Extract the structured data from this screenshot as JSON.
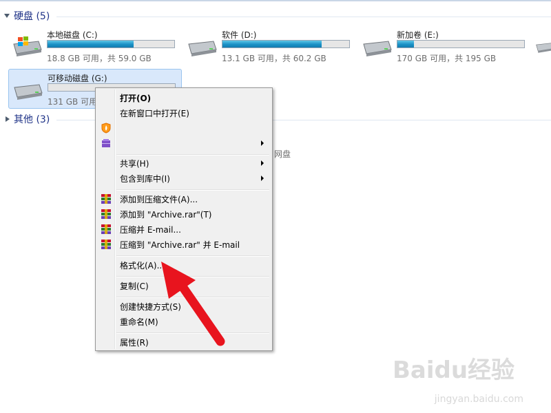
{
  "groups": {
    "disks": {
      "title": "硬盘 (5)"
    },
    "other": {
      "title": "其他 (3)"
    }
  },
  "drives": [
    {
      "name": "本地磁盘 (C:)",
      "free": "18.8 GB 可用，共 59.0 GB",
      "used_fraction": 0.68,
      "icon": "windows-drive-icon"
    },
    {
      "name": "软件 (D:)",
      "free": "13.1 GB 可用，共 60.2 GB",
      "used_fraction": 0.78,
      "icon": "hard-drive-icon"
    },
    {
      "name": "新加卷 (E:)",
      "free": "170 GB 可用，共 195 GB",
      "used_fraction": 0.13,
      "icon": "hard-drive-icon"
    },
    {
      "name": "可移动磁盘 (G:)",
      "free": "131 GB 可用",
      "used_fraction": 0.0,
      "icon": "removable-drive-icon"
    }
  ],
  "other_item_fragment": "网盘",
  "context_menu": {
    "open": "打开(O)",
    "open_new_window": "在新窗口中打开(E)",
    "share": "共享(H)",
    "include_library": "包含到库中(I)",
    "add_archive": "添加到压缩文件(A)...",
    "add_archive_rar": "添加到 \"Archive.rar\"(T)",
    "compress_email": "压缩并 E-mail...",
    "compress_rar_email": "压缩到 \"Archive.rar\" 并 E-mail",
    "format": "格式化(A)...",
    "copy": "复制(C)",
    "create_shortcut": "创建快捷方式(S)",
    "rename": "重命名(M)",
    "properties": "属性(R)"
  },
  "watermark": {
    "logo": "Baidu经验",
    "url": "jingyan.baidu.com"
  },
  "colors": {
    "accent_arrow": "#e8141e",
    "group_title": "#1e3287",
    "selection": "#d9e8fb"
  }
}
